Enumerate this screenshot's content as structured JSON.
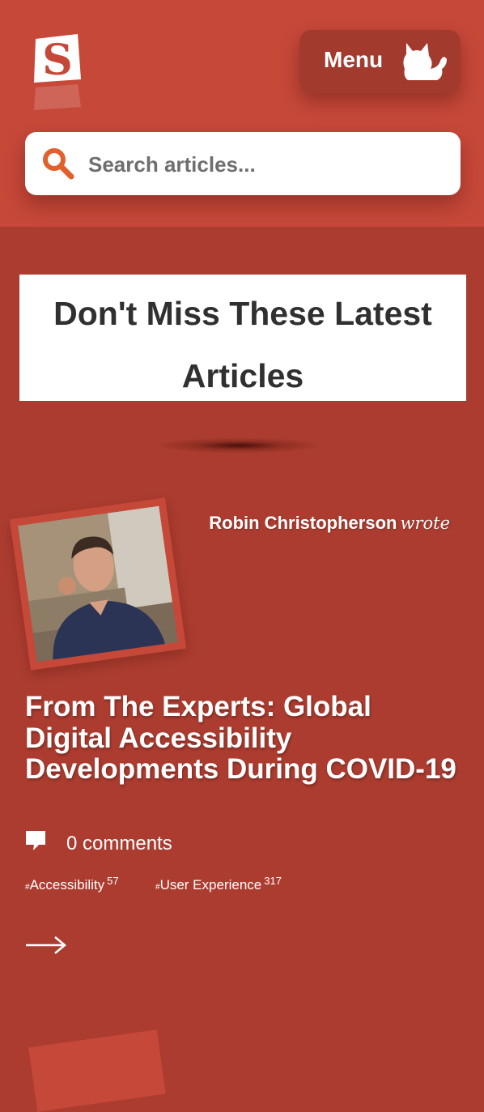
{
  "header": {
    "logo_letter": "S",
    "menu_label": "Menu",
    "menu_icon": "cat-icon"
  },
  "search": {
    "placeholder": "Search articles...",
    "icon": "search-icon"
  },
  "section": {
    "heading": "Don't Miss These Latest Articles"
  },
  "article": {
    "author_name": "Robin Christopherson",
    "author_verb": "wrote",
    "title": "From The Experts: Global Digital Accessibility Developments During COVID-19",
    "comments": "0 comments",
    "tags": [
      {
        "hash": "#",
        "name": "Accessibility",
        "count": "57"
      },
      {
        "hash": "#",
        "name": "User Experience",
        "count": "317"
      }
    ],
    "read_more_icon": "arrow-right-icon"
  },
  "colors": {
    "header_bg": "#c64839",
    "page_bg": "#ac3c30",
    "search_icon": "#e0612c",
    "heading_text": "#303030"
  }
}
